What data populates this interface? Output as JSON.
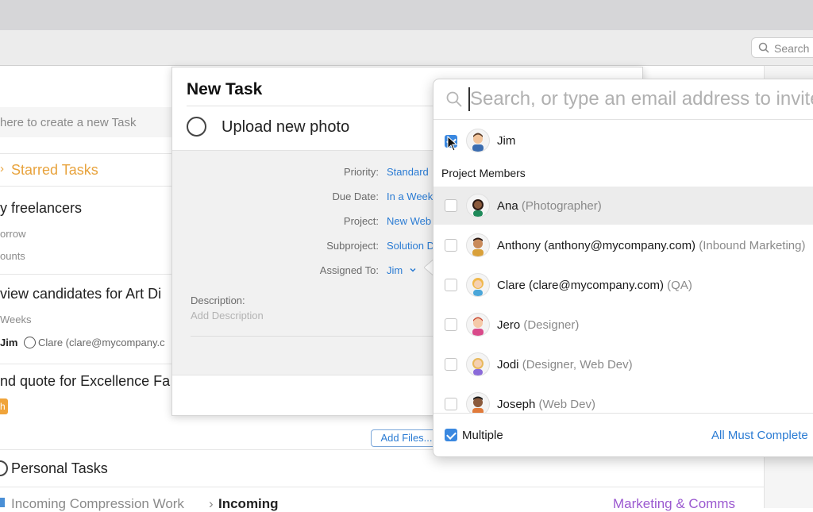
{
  "toolbar": {
    "search_placeholder": "Search"
  },
  "list": {
    "create_placeholder": "here to create a new Task",
    "starred_header": "Starred Tasks",
    "tasks": [
      {
        "title": "y freelancers",
        "sub1": "orrow",
        "sub2": "ounts"
      },
      {
        "title": "view candidates for Art Di",
        "sub1": "Weeks",
        "assignee": "Jim",
        "clare": "Clare (clare@mycompany.c"
      },
      {
        "title": "nd quote for Excellence Fa",
        "badge": "h"
      }
    ],
    "personal_header": "Personal Tasks",
    "breadcrumb_1": "Incoming Compression Work",
    "breadcrumb_sep": "›",
    "breadcrumb_2": "Incoming",
    "tag": "Marketing & Comms"
  },
  "dialog": {
    "title": "New Task",
    "task_name": "Upload new photo",
    "fields": [
      {
        "label": "Priority:",
        "value": "Standard"
      },
      {
        "label": "Due Date:",
        "value": "In a Week"
      },
      {
        "label": "Project:",
        "value": "New Web"
      },
      {
        "label": "Subproject:",
        "value": "Solution D"
      },
      {
        "label": "Assigned To:",
        "value": "Jim"
      }
    ],
    "description_label": "Description:",
    "description_placeholder": "Add Description",
    "add_files": "Add Files..."
  },
  "popover": {
    "search_placeholder": "Search, or type an email address to invite",
    "selected": {
      "name": "Jim",
      "checked": true
    },
    "section": "Project Members",
    "members": [
      {
        "name": "Ana",
        "role": "(Photographer)",
        "checked": false
      },
      {
        "name": "Anthony (anthony@mycompany.com)",
        "role": "(Inbound Marketing)",
        "checked": false
      },
      {
        "name": "Clare (clare@mycompany.com)",
        "role": "(QA)",
        "checked": false
      },
      {
        "name": "Jero",
        "role": "(Designer)",
        "checked": false
      },
      {
        "name": "Jodi",
        "role": "(Designer, Web Dev)",
        "checked": false
      },
      {
        "name": "Joseph",
        "role": "(Web Dev)",
        "checked": false
      }
    ],
    "multiple_label": "Multiple",
    "multiple_checked": true,
    "all_must_complete": "All Must Complete"
  },
  "colors": {
    "accent": "#2a7bd3",
    "starred": "#e8a33d",
    "tag": "#9b59d0",
    "badge": "#f0a43a"
  }
}
